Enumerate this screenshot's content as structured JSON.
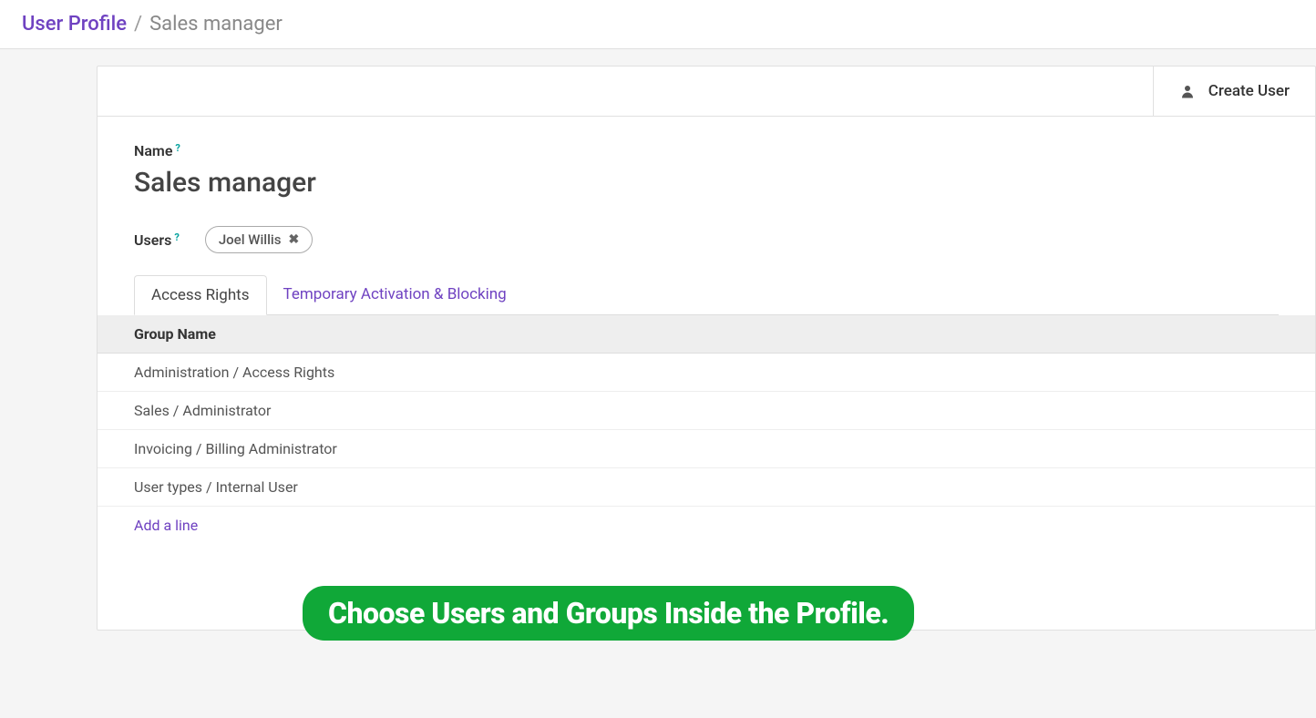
{
  "breadcrumb": {
    "root": "User Profile",
    "separator": "/",
    "current": "Sales manager"
  },
  "header": {
    "create_user_label": "Create User"
  },
  "form": {
    "name_label": "Name",
    "name_value": "Sales manager",
    "users_label": "Users",
    "users": [
      {
        "name": "Joel Willis"
      }
    ]
  },
  "tabs": {
    "access_rights": "Access Rights",
    "temporary": "Temporary Activation & Blocking"
  },
  "table": {
    "header": "Group Name",
    "rows": [
      "Administration / Access Rights",
      "Sales / Administrator",
      "Invoicing / Billing Administrator",
      "User types / Internal User"
    ],
    "add_line": "Add a line"
  },
  "overlay": {
    "message": "Choose Users and Groups Inside the Profile."
  },
  "help_symbol": "?",
  "remove_symbol": "✖"
}
